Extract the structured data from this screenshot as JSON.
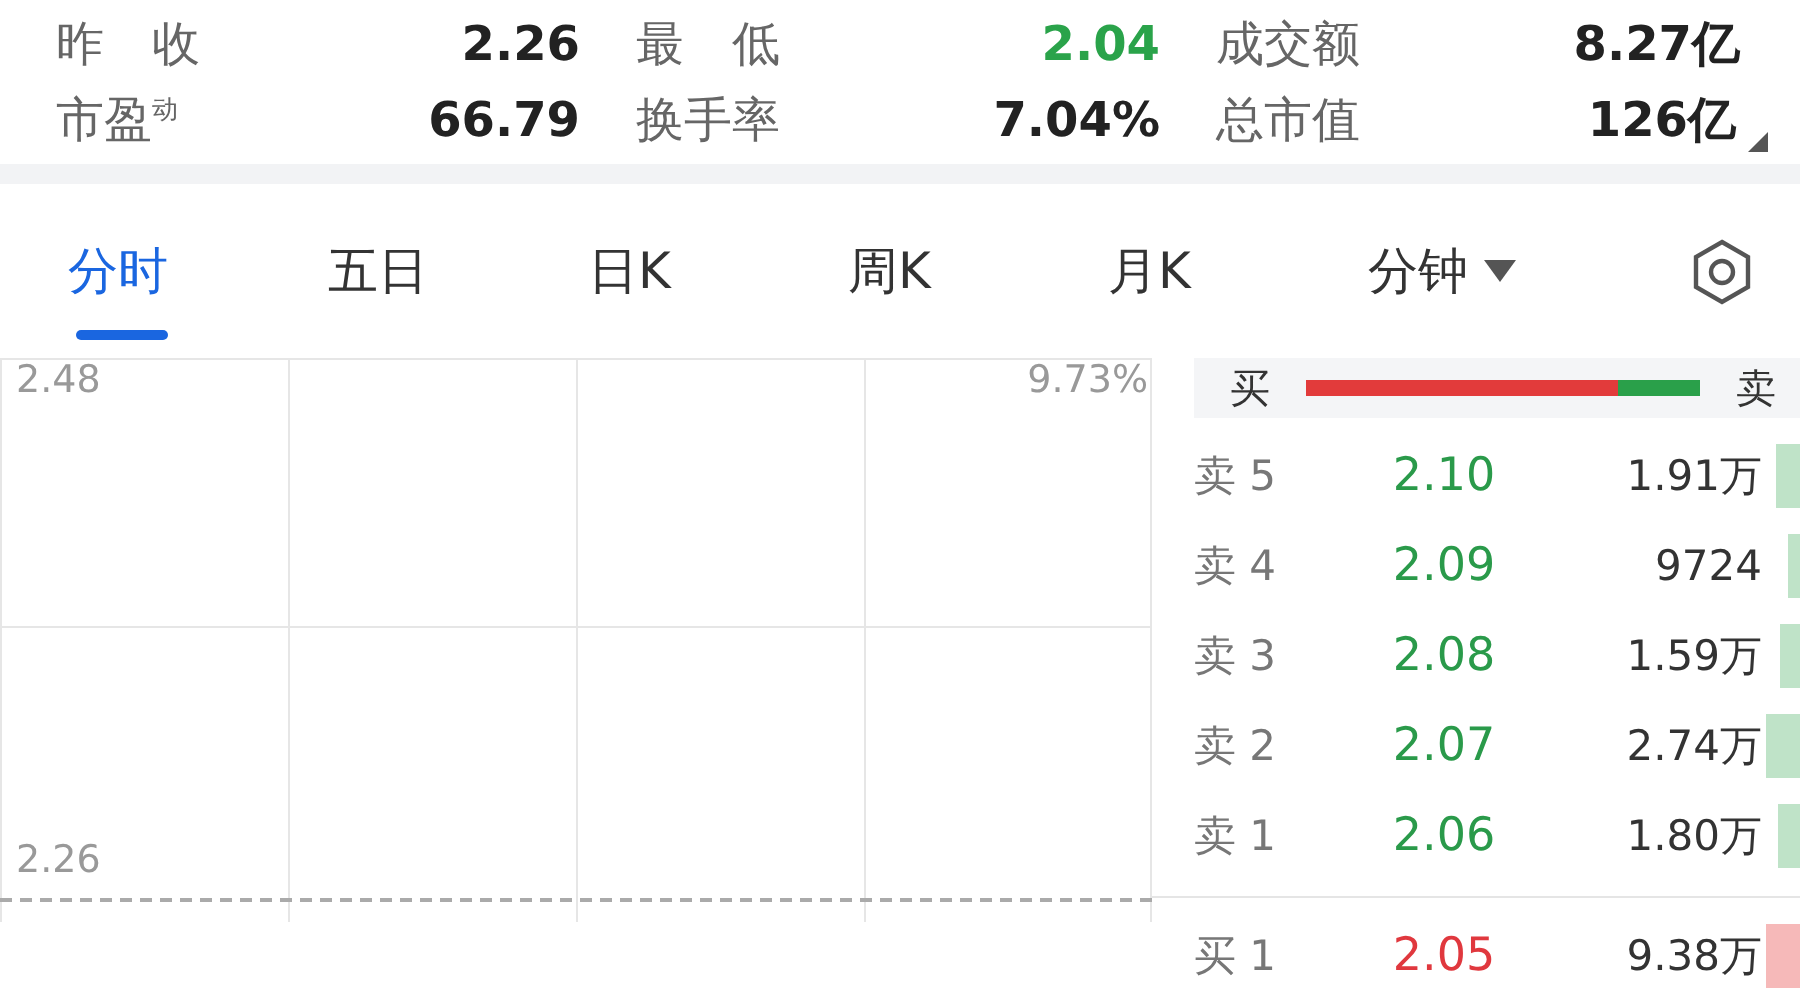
{
  "stats": [
    {
      "label": "昨　收",
      "value": "2.26",
      "color": "#222222"
    },
    {
      "label": "最　低",
      "value": "2.04",
      "color": "#2aa34a"
    },
    {
      "label": "成交额",
      "value": "8.27亿",
      "color": "#222222"
    },
    {
      "label": "市盈",
      "label_sup": "动",
      "value": "66.79",
      "color": "#222222"
    },
    {
      "label": "换手率",
      "value": "7.04%",
      "color": "#222222"
    },
    {
      "label": "总市值",
      "value": "126亿",
      "color": "#222222",
      "expand": true
    }
  ],
  "tabs": [
    {
      "label": "分时",
      "selected": true
    },
    {
      "label": "五日",
      "selected": false
    },
    {
      "label": "日K",
      "selected": false
    },
    {
      "label": "周K",
      "selected": false
    },
    {
      "label": "月K",
      "selected": false
    },
    {
      "label": "分钟",
      "selected": false,
      "dropdown": true
    }
  ],
  "chart": {
    "top_price": "2.48",
    "top_percent": "9.73%",
    "base_price": "2.26"
  },
  "order_book": {
    "buy_label": "买",
    "sell_label": "卖",
    "asks": [
      {
        "label": "卖 5",
        "price": "2.10",
        "volume": "1.91万"
      },
      {
        "label": "卖 4",
        "price": "2.09",
        "volume": "9724"
      },
      {
        "label": "卖 3",
        "price": "2.08",
        "volume": "1.59万"
      },
      {
        "label": "卖 2",
        "price": "2.07",
        "volume": "2.74万"
      },
      {
        "label": "卖 1",
        "price": "2.06",
        "volume": "1.80万"
      }
    ],
    "bids": [
      {
        "label": "买 1",
        "price": "2.05",
        "volume": "9.38万"
      }
    ]
  }
}
